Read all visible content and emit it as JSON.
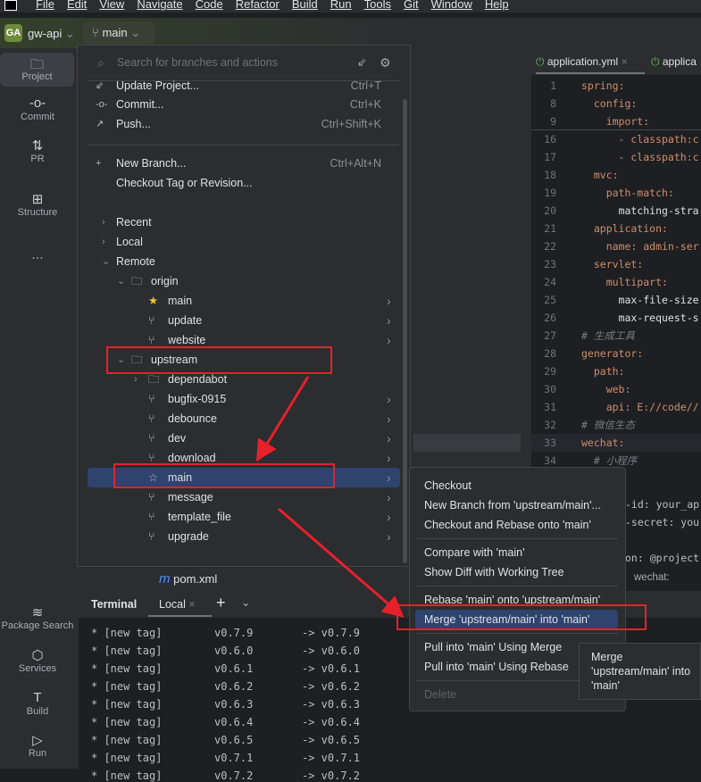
{
  "menubar": [
    "File",
    "Edit",
    "View",
    "Navigate",
    "Code",
    "Refactor",
    "Build",
    "Run",
    "Tools",
    "Git",
    "Window",
    "Help"
  ],
  "project": {
    "badge": "GA",
    "name": "gw-api"
  },
  "branch": {
    "current": "main"
  },
  "tools_top": [
    {
      "label": "Project",
      "icon": "folder-icon"
    },
    {
      "label": "Commit",
      "icon": "commit-icon"
    },
    {
      "label": "PR",
      "icon": "pull-request-icon"
    },
    {
      "label": "Structure",
      "icon": "structure-icon"
    },
    {
      "label": "...",
      "icon": "more-icon"
    }
  ],
  "tools_bottom": [
    {
      "label": "Package Search",
      "icon": "layers-icon"
    },
    {
      "label": "Services",
      "icon": "services-icon"
    },
    {
      "label": "Build",
      "icon": "hammer-icon"
    },
    {
      "label": "Run",
      "icon": "run-icon"
    }
  ],
  "popup": {
    "search_placeholder": "Search for branches and actions",
    "actions": [
      {
        "label": "Update Project...",
        "shortcut": "Ctrl+T"
      },
      {
        "label": "Commit...",
        "shortcut": "Ctrl+K"
      },
      {
        "label": "Push...",
        "shortcut": "Ctrl+Shift+K"
      },
      {
        "label": "New Branch...",
        "shortcut": "Ctrl+Alt+N"
      },
      {
        "label": "Checkout Tag or Revision...",
        "shortcut": ""
      }
    ],
    "tree": {
      "recent": "Recent",
      "local": "Local",
      "remote": "Remote",
      "origin": "origin",
      "origin_branches": [
        "main",
        "update",
        "website"
      ],
      "upstream": "upstream",
      "upstream_folder": "dependabot",
      "upstream_branches": [
        "bugfix-0915",
        "debounce",
        "dev",
        "download",
        "main",
        "message",
        "template_file",
        "upgrade"
      ]
    }
  },
  "editor": {
    "tabs": [
      "application.yml",
      "applica"
    ],
    "lines": [
      [
        "1",
        "spring:"
      ],
      [
        "8",
        "  config:"
      ],
      [
        "9",
        "    import:"
      ],
      [
        "16",
        "      - classpath:c"
      ],
      [
        "17",
        "      - classpath:c"
      ],
      [
        "18",
        "  mvc:"
      ],
      [
        "19",
        "    path-match:"
      ],
      [
        "20",
        "      matching-stra"
      ],
      [
        "21",
        "  application:"
      ],
      [
        "22",
        "    name: admin-ser"
      ],
      [
        "23",
        "  servlet:"
      ],
      [
        "24",
        "    multipart:"
      ],
      [
        "25",
        "      max-file-size"
      ],
      [
        "26",
        "      max-request-s"
      ],
      [
        "27",
        "# 生成工具"
      ],
      [
        "28",
        "generator:"
      ],
      [
        "29",
        "  path:"
      ],
      [
        "30",
        "    web:"
      ],
      [
        "31",
        "    api: E://code//"
      ],
      [
        "32",
        "# 微信生态"
      ],
      [
        "33",
        "wechat:"
      ],
      [
        "34",
        "  # 小程序"
      ]
    ],
    "partial_lines": [
      "-id: your_ap",
      "-secret: you",
      "on: @project"
    ],
    "breadcrumb": "wechat:"
  },
  "filetree": {
    "pom": "pom.xml"
  },
  "terminal": {
    "title": "Terminal",
    "tab": "Local",
    "lines": [
      [
        "* [new tag]",
        "v0.7.9",
        "-> v0.7.9"
      ],
      [
        "* [new tag]",
        "v0.6.0",
        "-> v0.6.0"
      ],
      [
        "* [new tag]",
        "v0.6.1",
        "-> v0.6.1"
      ],
      [
        "* [new tag]",
        "v0.6.2",
        "-> v0.6.2"
      ],
      [
        "* [new tag]",
        "v0.6.3",
        "-> v0.6.3"
      ],
      [
        "* [new tag]",
        "v0.6.4",
        "-> v0.6.4"
      ],
      [
        "* [new tag]",
        "v0.6.5",
        "-> v0.6.5"
      ],
      [
        "* [new tag]",
        "v0.7.1",
        "-> v0.7.1"
      ],
      [
        "* [new tag]",
        "v0.7.2",
        "-> v0.7.2"
      ]
    ]
  },
  "context_menu": {
    "groups": [
      [
        "Checkout",
        "New Branch from 'upstream/main'...",
        "Checkout and Rebase onto 'main'"
      ],
      [
        "Compare with 'main'",
        "Show Diff with Working Tree"
      ],
      [
        "Rebase 'main' onto 'upstream/main'",
        "Merge 'upstream/main' into 'main'"
      ],
      [
        "Pull into 'main' Using Merge",
        "Pull into 'main' Using Rebase"
      ],
      [
        "Delete"
      ]
    ],
    "selected": "Merge 'upstream/main' into 'main'"
  },
  "tooltip": "Merge 'upstream/main' into 'main'",
  "colors": {
    "selection": "#2e436e",
    "annotation": "#e8202a",
    "star": "#f0c43c"
  }
}
